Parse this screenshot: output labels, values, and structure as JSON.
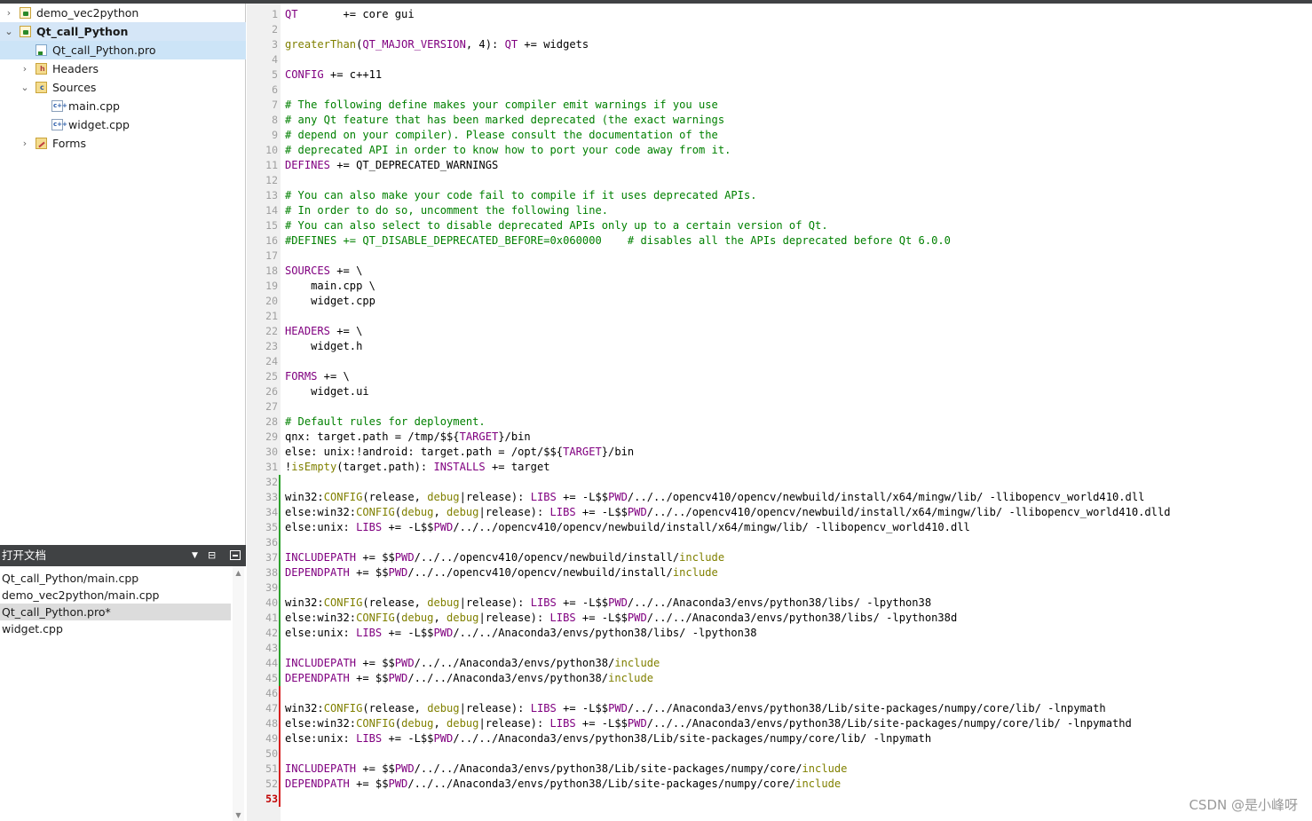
{
  "project_tree": [
    {
      "label": "demo_vec2python",
      "chevron": "›",
      "icon": "project-icon",
      "level": 0
    },
    {
      "label": "Qt_call_Python",
      "chevron": "⌄",
      "icon": "project-icon",
      "level": 0
    },
    {
      "label": "Qt_call_Python.pro",
      "chevron": "",
      "icon": "pro-file-icon",
      "level": 1
    },
    {
      "label": "Headers",
      "chevron": "›",
      "icon": "headers-folder-icon",
      "level": 1
    },
    {
      "label": "Sources",
      "chevron": "⌄",
      "icon": "sources-folder-icon",
      "level": 1
    },
    {
      "label": "main.cpp",
      "chevron": "",
      "icon": "cpp-file-icon",
      "level": 2
    },
    {
      "label": "widget.cpp",
      "chevron": "",
      "icon": "cpp-file-icon",
      "level": 2
    },
    {
      "label": "Forms",
      "chevron": "›",
      "icon": "forms-folder-icon",
      "level": 1
    }
  ],
  "open_documents": {
    "title": "打开文档",
    "items": [
      "Qt_call_Python/main.cpp",
      "demo_vec2python/main.cpp",
      "Qt_call_Python.pro*",
      "widget.cpp"
    ],
    "selected_index": 2
  },
  "editor": {
    "current_line": 53,
    "changed_from_line": 32,
    "lines": [
      [
        [
          "kw",
          "QT"
        ],
        [
          "t",
          "       += core gui"
        ]
      ],
      [],
      [
        [
          "fn",
          "greaterThan"
        ],
        [
          "t",
          "("
        ],
        [
          "kw",
          "QT_MAJOR_VERSION"
        ],
        [
          "t",
          ", 4): "
        ],
        [
          "kw",
          "QT"
        ],
        [
          "t",
          " += widgets"
        ]
      ],
      [],
      [
        [
          "kw",
          "CONFIG"
        ],
        [
          "t",
          " += c++11"
        ]
      ],
      [],
      [
        [
          "cm",
          "# The following define makes your compiler emit warnings if you use"
        ]
      ],
      [
        [
          "cm",
          "# any Qt feature that has been marked deprecated (the exact warnings"
        ]
      ],
      [
        [
          "cm",
          "# depend on your compiler). Please consult the documentation of the"
        ]
      ],
      [
        [
          "cm",
          "# deprecated API in order to know how to port your code away from it."
        ]
      ],
      [
        [
          "kw",
          "DEFINES"
        ],
        [
          "t",
          " += QT_DEPRECATED_WARNINGS"
        ]
      ],
      [],
      [
        [
          "cm",
          "# You can also make your code fail to compile if it uses deprecated APIs."
        ]
      ],
      [
        [
          "cm",
          "# In order to do so, uncomment the following line."
        ]
      ],
      [
        [
          "cm",
          "# You can also select to disable deprecated APIs only up to a certain version of Qt."
        ]
      ],
      [
        [
          "cm",
          "#DEFINES += QT_DISABLE_DEPRECATED_BEFORE=0x060000    # disables all the APIs deprecated before Qt 6.0.0"
        ]
      ],
      [],
      [
        [
          "kw",
          "SOURCES"
        ],
        [
          "t",
          " += \\"
        ]
      ],
      [
        [
          "t",
          "    main.cpp \\"
        ]
      ],
      [
        [
          "t",
          "    widget.cpp"
        ]
      ],
      [],
      [
        [
          "kw",
          "HEADERS"
        ],
        [
          "t",
          " += \\"
        ]
      ],
      [
        [
          "t",
          "    widget.h"
        ]
      ],
      [],
      [
        [
          "kw",
          "FORMS"
        ],
        [
          "t",
          " += \\"
        ]
      ],
      [
        [
          "t",
          "    widget.ui"
        ]
      ],
      [],
      [
        [
          "cm",
          "# Default rules for deployment."
        ]
      ],
      [
        [
          "t",
          "qnx: target.path = /tmp/$${"
        ],
        [
          "kw",
          "TARGET"
        ],
        [
          "t",
          "}/bin"
        ]
      ],
      [
        [
          "t",
          "else: unix:!android: target.path = /opt/$${"
        ],
        [
          "kw",
          "TARGET"
        ],
        [
          "t",
          "}/bin"
        ]
      ],
      [
        [
          "t",
          "!"
        ],
        [
          "fn",
          "isEmpty"
        ],
        [
          "t",
          "(target.path): "
        ],
        [
          "kw",
          "INSTALLS"
        ],
        [
          "t",
          " += target"
        ]
      ],
      [],
      [
        [
          "t",
          "win32:"
        ],
        [
          "fn",
          "CONFIG"
        ],
        [
          "t",
          "(release, "
        ],
        [
          "fn",
          "debug"
        ],
        [
          "t",
          "|release): "
        ],
        [
          "kw",
          "LIBS"
        ],
        [
          "t",
          " += -L$$"
        ],
        [
          "kw",
          "PWD"
        ],
        [
          "t",
          "/../../opencv410/opencv/newbuild/install/x64/mingw/lib/ -llibopencv_world410.dll"
        ]
      ],
      [
        [
          "t",
          "else:win32:"
        ],
        [
          "fn",
          "CONFIG"
        ],
        [
          "t",
          "("
        ],
        [
          "fn",
          "debug"
        ],
        [
          "t",
          ", "
        ],
        [
          "fn",
          "debug"
        ],
        [
          "t",
          "|release): "
        ],
        [
          "kw",
          "LIBS"
        ],
        [
          "t",
          " += -L$$"
        ],
        [
          "kw",
          "PWD"
        ],
        [
          "t",
          "/../../opencv410/opencv/newbuild/install/x64/mingw/lib/ -llibopencv_world410.dlld"
        ]
      ],
      [
        [
          "t",
          "else:unix: "
        ],
        [
          "kw",
          "LIBS"
        ],
        [
          "t",
          " += -L$$"
        ],
        [
          "kw",
          "PWD"
        ],
        [
          "t",
          "/../../opencv410/opencv/newbuild/install/x64/mingw/lib/ -llibopencv_world410.dll"
        ]
      ],
      [],
      [
        [
          "kw",
          "INCLUDEPATH"
        ],
        [
          "t",
          " += $$"
        ],
        [
          "kw",
          "PWD"
        ],
        [
          "t",
          "/../../opencv410/opencv/newbuild/install/"
        ],
        [
          "inc",
          "include"
        ]
      ],
      [
        [
          "kw",
          "DEPENDPATH"
        ],
        [
          "t",
          " += $$"
        ],
        [
          "kw",
          "PWD"
        ],
        [
          "t",
          "/../../opencv410/opencv/newbuild/install/"
        ],
        [
          "inc",
          "include"
        ]
      ],
      [],
      [
        [
          "t",
          "win32:"
        ],
        [
          "fn",
          "CONFIG"
        ],
        [
          "t",
          "(release, "
        ],
        [
          "fn",
          "debug"
        ],
        [
          "t",
          "|release): "
        ],
        [
          "kw",
          "LIBS"
        ],
        [
          "t",
          " += -L$$"
        ],
        [
          "kw",
          "PWD"
        ],
        [
          "t",
          "/../../Anaconda3/envs/python38/libs/ -lpython38"
        ]
      ],
      [
        [
          "t",
          "else:win32:"
        ],
        [
          "fn",
          "CONFIG"
        ],
        [
          "t",
          "("
        ],
        [
          "fn",
          "debug"
        ],
        [
          "t",
          ", "
        ],
        [
          "fn",
          "debug"
        ],
        [
          "t",
          "|release): "
        ],
        [
          "kw",
          "LIBS"
        ],
        [
          "t",
          " += -L$$"
        ],
        [
          "kw",
          "PWD"
        ],
        [
          "t",
          "/../../Anaconda3/envs/python38/libs/ -lpython38d"
        ]
      ],
      [
        [
          "t",
          "else:unix: "
        ],
        [
          "kw",
          "LIBS"
        ],
        [
          "t",
          " += -L$$"
        ],
        [
          "kw",
          "PWD"
        ],
        [
          "t",
          "/../../Anaconda3/envs/python38/libs/ -lpython38"
        ]
      ],
      [],
      [
        [
          "kw",
          "INCLUDEPATH"
        ],
        [
          "t",
          " += $$"
        ],
        [
          "kw",
          "PWD"
        ],
        [
          "t",
          "/../../Anaconda3/envs/python38/"
        ],
        [
          "inc",
          "include"
        ]
      ],
      [
        [
          "kw",
          "DEPENDPATH"
        ],
        [
          "t",
          " += $$"
        ],
        [
          "kw",
          "PWD"
        ],
        [
          "t",
          "/../../Anaconda3/envs/python38/"
        ],
        [
          "inc",
          "include"
        ]
      ],
      [],
      [
        [
          "t",
          "win32:"
        ],
        [
          "fn",
          "CONFIG"
        ],
        [
          "t",
          "(release, "
        ],
        [
          "fn",
          "debug"
        ],
        [
          "t",
          "|release): "
        ],
        [
          "kw",
          "LIBS"
        ],
        [
          "t",
          " += -L$$"
        ],
        [
          "kw",
          "PWD"
        ],
        [
          "t",
          "/../../Anaconda3/envs/python38/Lib/site-packages/numpy/core/lib/ -lnpymath"
        ]
      ],
      [
        [
          "t",
          "else:win32:"
        ],
        [
          "fn",
          "CONFIG"
        ],
        [
          "t",
          "("
        ],
        [
          "fn",
          "debug"
        ],
        [
          "t",
          ", "
        ],
        [
          "fn",
          "debug"
        ],
        [
          "t",
          "|release): "
        ],
        [
          "kw",
          "LIBS"
        ],
        [
          "t",
          " += -L$$"
        ],
        [
          "kw",
          "PWD"
        ],
        [
          "t",
          "/../../Anaconda3/envs/python38/Lib/site-packages/numpy/core/lib/ -lnpymathd"
        ]
      ],
      [
        [
          "t",
          "else:unix: "
        ],
        [
          "kw",
          "LIBS"
        ],
        [
          "t",
          " += -L$$"
        ],
        [
          "kw",
          "PWD"
        ],
        [
          "t",
          "/../../Anaconda3/envs/python38/Lib/site-packages/numpy/core/lib/ -lnpymath"
        ]
      ],
      [],
      [
        [
          "kw",
          "INCLUDEPATH"
        ],
        [
          "t",
          " += $$"
        ],
        [
          "kw",
          "PWD"
        ],
        [
          "t",
          "/../../Anaconda3/envs/python38/Lib/site-packages/numpy/core/"
        ],
        [
          "inc",
          "include"
        ]
      ],
      [
        [
          "kw",
          "DEPENDPATH"
        ],
        [
          "t",
          " += $$"
        ],
        [
          "kw",
          "PWD"
        ],
        [
          "t",
          "/../../Anaconda3/envs/python38/Lib/site-packages/numpy/core/"
        ],
        [
          "inc",
          "include"
        ]
      ],
      []
    ]
  },
  "watermark": "CSDN @是小峰呀",
  "colors": {
    "keyword": "#800080",
    "comment": "#008000",
    "function": "#808000",
    "changed_bar_green": "#2ca02c",
    "changed_bar_red": "#d62020",
    "dock_header": "#404244",
    "selection": "#d5e6f7"
  }
}
